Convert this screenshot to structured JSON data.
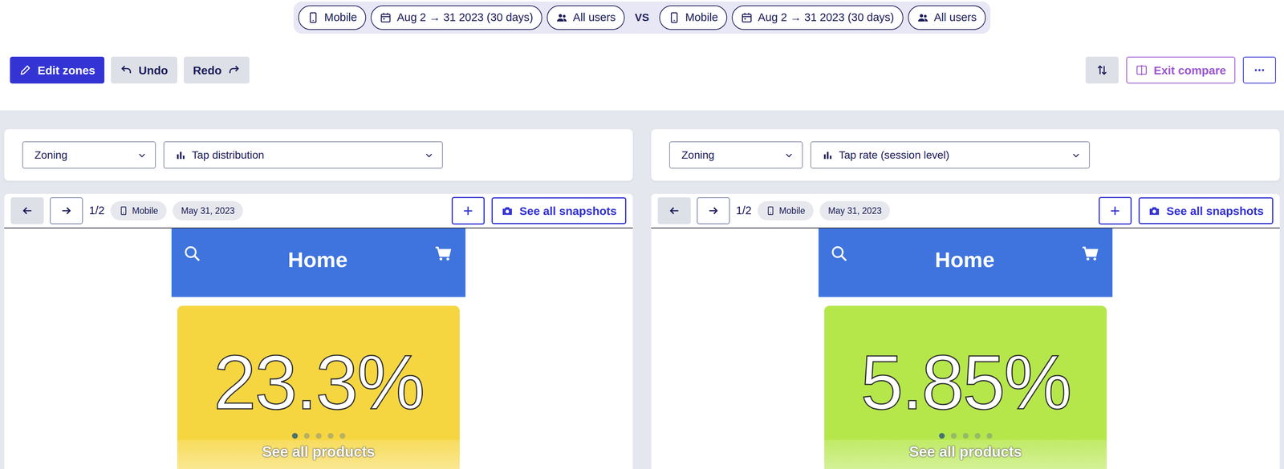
{
  "compare": {
    "left": {
      "device": "Mobile",
      "dates": "Aug 2 → 31 2023 (30 days)",
      "segment": "All users"
    },
    "vs": "VS",
    "right": {
      "device": "Mobile",
      "dates": "Aug 2 → 31 2023 (30 days)",
      "segment": "All users"
    }
  },
  "toolbar": {
    "edit": "Edit zones",
    "undo": "Undo",
    "redo": "Redo",
    "exit": "Exit compare"
  },
  "panels": [
    {
      "mode": "Zoning",
      "metric": "Tap distribution",
      "prev_disabled": true,
      "counter": "1/2",
      "device": "Mobile",
      "date": "May 31, 2023",
      "add": "+",
      "snapshots": "See all snapshots",
      "screen": {
        "title": "Home",
        "value": "23.3%",
        "color": "#f6d640",
        "cta": "See all products",
        "dots": [
          {
            "selected": true
          },
          {
            "selected": false
          },
          {
            "selected": false
          },
          {
            "selected": false
          },
          {
            "selected": false
          }
        ]
      }
    },
    {
      "mode": "Zoning",
      "metric": "Tap rate (session level)",
      "prev_disabled": true,
      "counter": "1/2",
      "device": "Mobile",
      "date": "May 31, 2023",
      "add": "+",
      "snapshots": "See all snapshots",
      "screen": {
        "title": "Home",
        "value": "5.85%",
        "color": "#b5e74b",
        "cta": "See all products",
        "dots": [
          {
            "selected": true
          },
          {
            "selected": false
          },
          {
            "selected": false
          },
          {
            "selected": false
          },
          {
            "selected": false
          }
        ]
      }
    }
  ]
}
